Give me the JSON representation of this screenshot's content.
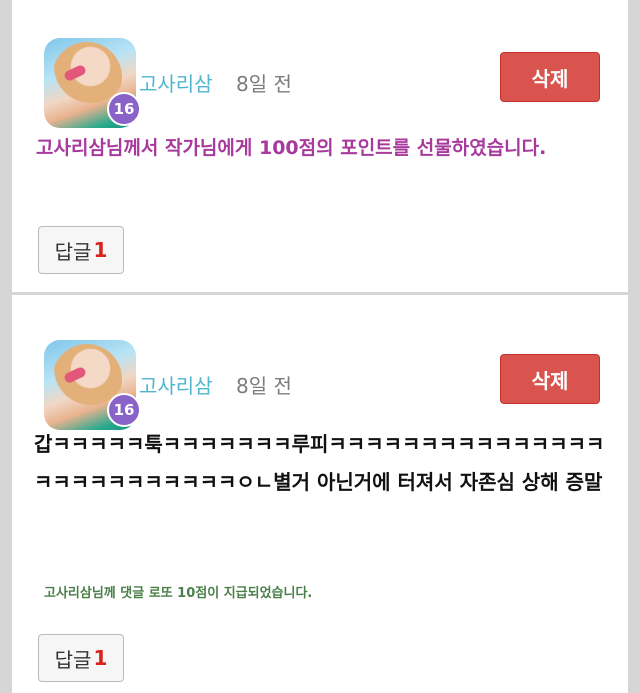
{
  "comments": [
    {
      "username": "고사리삼",
      "time": "8일 전",
      "level": "16",
      "delete_label": "삭제",
      "text": "고사리삼님께서 작가님에게 100점의 포인트를 선물하였습니다.",
      "reply_label": "답글",
      "reply_count": "1",
      "text_color": "#a83a9e"
    },
    {
      "username": "고사리삼",
      "time": "8일 전",
      "level": "16",
      "delete_label": "삭제",
      "text": "갑ㅋㅋㅋㅋㅋ툭ㅋㅋㅋㅋㅋㅋㅋ루피ㅋㅋㅋㅋㅋㅋㅋㅋㅋㅋㅋㅋㅋㅋㅋㅋㅋㅋㅋㅋㅋㅋㅋㅋㅋㅋㅇㄴ별거 아닌거에 터져서 자존심 상해 증말",
      "notice": "고사리삼님께 댓글 로또 10점이 지급되었습니다.",
      "reply_label": "답글",
      "reply_count": "1"
    }
  ],
  "colors": {
    "username": "#4fb6d0",
    "delete_button": "#d9534f",
    "level_badge": "#8a63c8",
    "notice": "#4a7f4a"
  }
}
